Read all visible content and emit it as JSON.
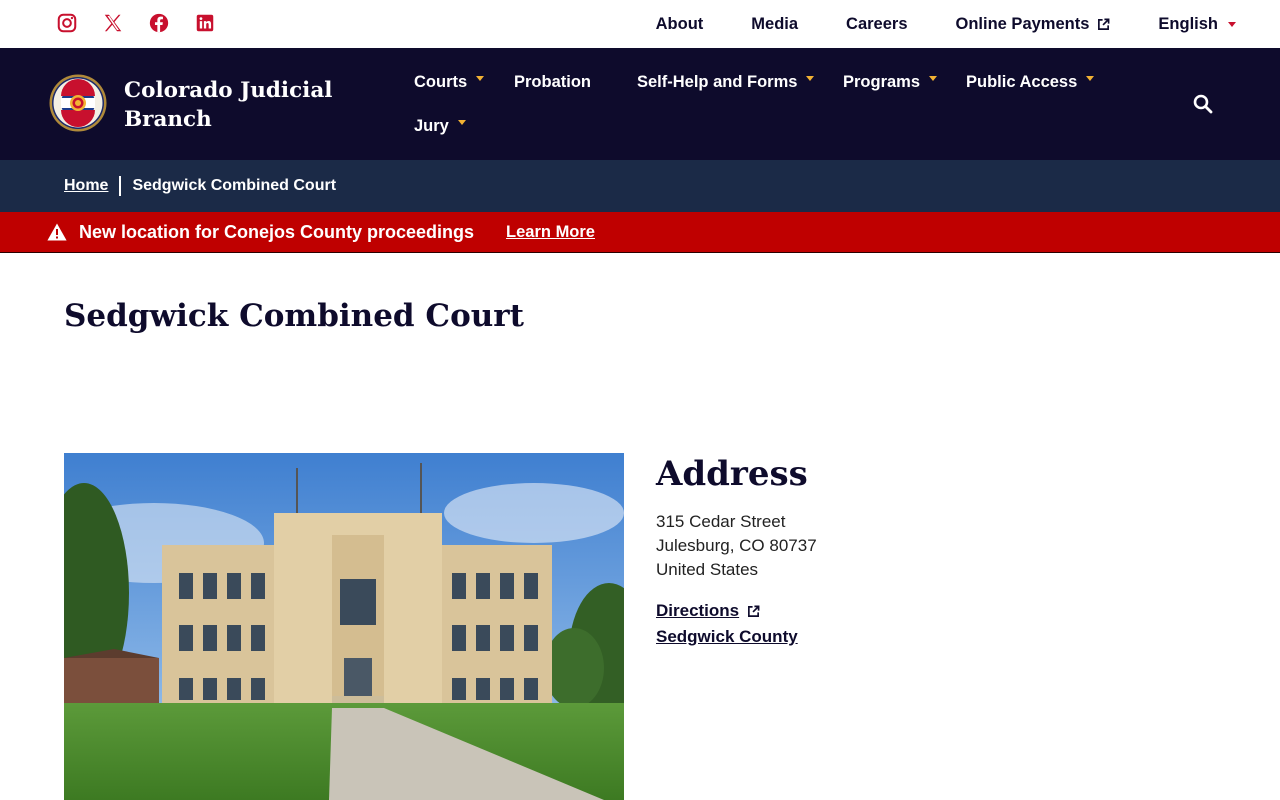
{
  "colors": {
    "navy": "#0e0b2c",
    "breadcrumb_bg": "#1b2a47",
    "alert_red": "#bf0000",
    "social_red": "#c8102e",
    "caret_gold": "#f2b233"
  },
  "social": [
    {
      "name": "instagram-icon"
    },
    {
      "name": "x-icon"
    },
    {
      "name": "facebook-icon"
    },
    {
      "name": "linkedin-icon"
    }
  ],
  "utility_links": {
    "about": "About",
    "media": "Media",
    "careers": "Careers",
    "online_payments": "Online Payments",
    "language": "English"
  },
  "header": {
    "logo_icon": "colorado-courts-seal-icon",
    "site_name": "Colorado Judicial Branch"
  },
  "nav": {
    "courts": "Courts",
    "probation": "Probation",
    "self_help": "Self-Help and Forms",
    "programs": "Programs",
    "public_access": "Public Access",
    "jury": "Jury"
  },
  "breadcrumb": {
    "home": "Home",
    "current": "Sedgwick Combined Court"
  },
  "alert": {
    "message": "New location for Conejos County proceedings",
    "link": "Learn More"
  },
  "page": {
    "title": "Sedgwick Combined Court"
  },
  "address": {
    "heading": "Address",
    "line1": "315 Cedar Street",
    "line2": "Julesburg, CO 80737",
    "line3": "United States",
    "directions": "Directions",
    "county": "Sedgwick County"
  }
}
